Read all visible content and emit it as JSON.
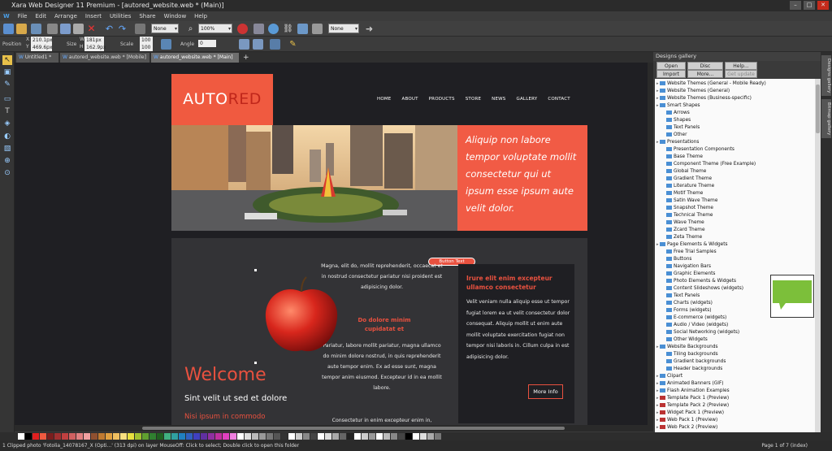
{
  "window": {
    "title": "Xara Web Designer 11 Premium - [autored_website.web * (Main)]"
  },
  "menu": [
    "File",
    "Edit",
    "Arrange",
    "Insert",
    "Utilities",
    "Share",
    "Window",
    "Help"
  ],
  "toolbar": {
    "fill_combo": "None",
    "zoom_combo": "100%",
    "line_combo": "None"
  },
  "infobar": {
    "position_label": "Position",
    "x_label": "X",
    "x_value": "210.1px",
    "y_label": "Y",
    "y_value": "469.6px",
    "size_label": "Size",
    "w_label": "W",
    "w_value": "181px",
    "h_label": "H",
    "h_value": "162.9px",
    "scale_label": "Scale",
    "sw_value": "100",
    "sh_value": "100",
    "angle_label": "Angle",
    "angle_value": "0"
  },
  "tabs": [
    {
      "label": "Untitled1 *"
    },
    {
      "label": "autored_website.web * [Mobile]"
    },
    {
      "label": "autored_website.web * [Main]"
    }
  ],
  "site": {
    "logo_a": "AUTO",
    "logo_b": "RED",
    "nav": [
      "HOME",
      "ABOUT",
      "PRODUCTS",
      "STORE",
      "NEWS",
      "GALLERY",
      "CONTACT"
    ],
    "hero_text": "Aliquip non labore tempor voluptate mollit consectetur qui ut ipsum esse ipsum aute velit dolor.",
    "button_text": "Button Text",
    "mid_para1": "Magna, elit do, mollit reprehenderit, occaecat et in nostrud consectetur pariatur nisi proident est adipisicing dolor.",
    "mid_heading": "Do dolore minim cupidatat et",
    "mid_para2": "Pariatur, labore mollit pariatur, magna ullamco do minim dolore nostrud, in quis reprehenderit aute tempor enim. Ex ad esse sunt, magna tempor anim eiusmod. Excepteur id in ea mollit labore.",
    "mid_para3": "Consectetur in enim excepteur enim in,",
    "side_heading": "Irure elit enim excepteur ullamco consectetur",
    "side_para": "Velit veniam nulla aliquip esse ut tempor fugiat lorem ea ut velit consectetur dolor consequat. Aliquip mollit ut enim aute mollit voluptate exercitation fugiat non tempor nisi laboris in. Cillum culpa in est adipisicing dolor.",
    "more_info": "More Info",
    "welcome": "Welcome",
    "sint": "Sint velit ut sed et dolore",
    "nisi": "Nisi ipsum in commodo"
  },
  "gallery": {
    "title": "Designs gallery",
    "buttons": [
      "Open",
      "Disc designs...",
      "Help...",
      "Import",
      "More...",
      "Get update"
    ],
    "side_tabs": [
      "Designs gallery",
      "Bitmap gallery"
    ],
    "items": [
      {
        "label": "Website Themes (General - Mobile Ready)",
        "level": 0,
        "color": "blue"
      },
      {
        "label": "Website Themes (General)",
        "level": 0,
        "color": "blue"
      },
      {
        "label": "Website Themes (Business-specific)",
        "level": 0,
        "color": "blue"
      },
      {
        "label": "Smart Shapes",
        "level": 0,
        "color": "blue"
      },
      {
        "label": "Arrows",
        "level": 1,
        "color": "blue"
      },
      {
        "label": "Shapes",
        "level": 1,
        "color": "blue"
      },
      {
        "label": "Text Panels",
        "level": 1,
        "color": "blue"
      },
      {
        "label": "Other",
        "level": 1,
        "color": "blue"
      },
      {
        "label": "Presentations",
        "level": 0,
        "color": "blue"
      },
      {
        "label": "Presentation Components",
        "level": 1,
        "color": "blue"
      },
      {
        "label": "Base Theme",
        "level": 1,
        "color": "blue"
      },
      {
        "label": "Component Theme (Free Example)",
        "level": 1,
        "color": "blue"
      },
      {
        "label": "Global Theme",
        "level": 1,
        "color": "blue"
      },
      {
        "label": "Gradient Theme",
        "level": 1,
        "color": "blue"
      },
      {
        "label": "Literature Theme",
        "level": 1,
        "color": "blue"
      },
      {
        "label": "Motif Theme",
        "level": 1,
        "color": "blue"
      },
      {
        "label": "Satin Wave Theme",
        "level": 1,
        "color": "blue"
      },
      {
        "label": "Snapshot Theme",
        "level": 1,
        "color": "blue"
      },
      {
        "label": "Technical Theme",
        "level": 1,
        "color": "blue"
      },
      {
        "label": "Wave Theme",
        "level": 1,
        "color": "blue"
      },
      {
        "label": "Zcard Theme",
        "level": 1,
        "color": "blue"
      },
      {
        "label": "Zeta Theme",
        "level": 1,
        "color": "blue"
      },
      {
        "label": "Page Elements & Widgets",
        "level": 0,
        "color": "blue"
      },
      {
        "label": "Free Trial Samples",
        "level": 1,
        "color": "blue"
      },
      {
        "label": "Buttons",
        "level": 1,
        "color": "blue"
      },
      {
        "label": "Navigation Bars",
        "level": 1,
        "color": "blue"
      },
      {
        "label": "Graphic Elements",
        "level": 1,
        "color": "blue"
      },
      {
        "label": "Photo Elements & Widgets",
        "level": 1,
        "color": "blue"
      },
      {
        "label": "Content Slideshows (widgets)",
        "level": 1,
        "color": "blue"
      },
      {
        "label": "Text Panels",
        "level": 1,
        "color": "blue"
      },
      {
        "label": "Charts (widgets)",
        "level": 1,
        "color": "blue"
      },
      {
        "label": "Forms (widgets)",
        "level": 1,
        "color": "blue"
      },
      {
        "label": "E-commerce (widgets)",
        "level": 1,
        "color": "blue"
      },
      {
        "label": "Audio / Video (widgets)",
        "level": 1,
        "color": "blue"
      },
      {
        "label": "Social Networking (widgets)",
        "level": 1,
        "color": "blue"
      },
      {
        "label": "Other Widgets",
        "level": 1,
        "color": "blue"
      },
      {
        "label": "Website Backgrounds",
        "level": 0,
        "color": "blue"
      },
      {
        "label": "Tiling backgrounds",
        "level": 1,
        "color": "blue"
      },
      {
        "label": "Gradient backgrounds",
        "level": 1,
        "color": "blue"
      },
      {
        "label": "Header backgrounds",
        "level": 1,
        "color": "blue"
      },
      {
        "label": "Clipart",
        "level": 0,
        "color": "blue"
      },
      {
        "label": "Animated Banners (GIF)",
        "level": 0,
        "color": "blue"
      },
      {
        "label": "Flash Animation Examples",
        "level": 0,
        "color": "blue"
      },
      {
        "label": "Template Pack 1 (Preview)",
        "level": 0,
        "color": "red"
      },
      {
        "label": "Template Pack 2 (Preview)",
        "level": 0,
        "color": "red"
      },
      {
        "label": "Widget Pack 1 (Preview)",
        "level": 0,
        "color": "red"
      },
      {
        "label": "Web Pack 1 (Preview)",
        "level": 0,
        "color": "red"
      },
      {
        "label": "Web Pack 2 (Preview)",
        "level": 0,
        "color": "red"
      }
    ]
  },
  "status": {
    "text": "1 Clipped photo 'Fotolia_14078167_X (Opti...' (313 dpi) on layer MouseOff: Click to select; Double click to open this folder",
    "page_indicator": "Page 1 of 7 (index)"
  },
  "colors": {
    "accent": "#f05a40",
    "accent_dark": "#c0271b",
    "canvas": "#1f1f23"
  }
}
